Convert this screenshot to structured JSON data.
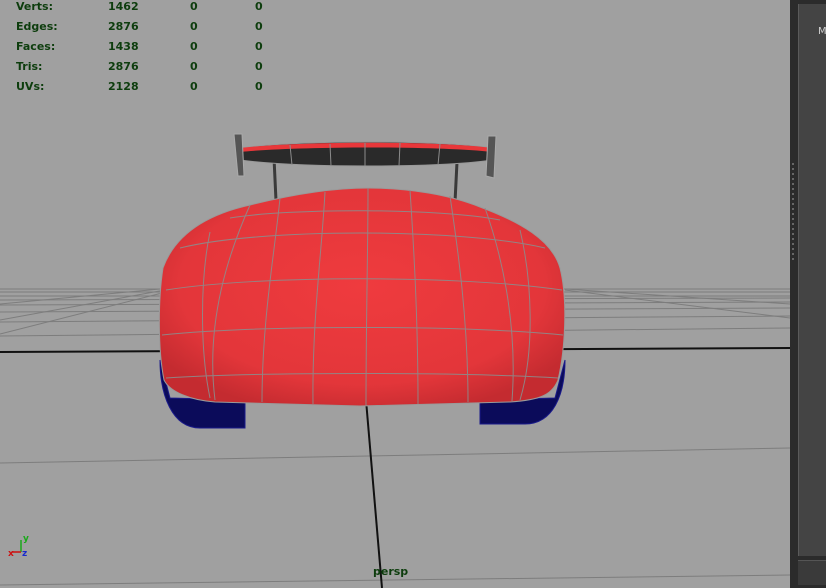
{
  "hud": {
    "rows": [
      {
        "label": "Verts:",
        "v1": "1462",
        "v2": "0",
        "v3": "0"
      },
      {
        "label": "Edges:",
        "v1": "2876",
        "v2": "0",
        "v3": "0"
      },
      {
        "label": "Faces:",
        "v1": "1438",
        "v2": "0",
        "v3": "0"
      },
      {
        "label": "Tris:",
        "v1": "2876",
        "v2": "0",
        "v3": "0"
      },
      {
        "label": "UVs:",
        "v1": "2128",
        "v2": "0",
        "v3": "0"
      }
    ]
  },
  "camera": {
    "name": "persp"
  },
  "axis": {
    "x": "x",
    "y": "y",
    "z": "z"
  },
  "side_panel": {
    "label": "M"
  },
  "colors": {
    "viewport_bg": "#a0a0a0",
    "hud_text": "#0d3d0d",
    "car_body": "#e8373a",
    "wireframe": "#8a8a8a",
    "wheels": "#0b0b5a",
    "spoiler_dark": "#2a2a2a",
    "axis_x": "#cc1111",
    "axis_y": "#1aa81a",
    "axis_z": "#1a2acc"
  }
}
